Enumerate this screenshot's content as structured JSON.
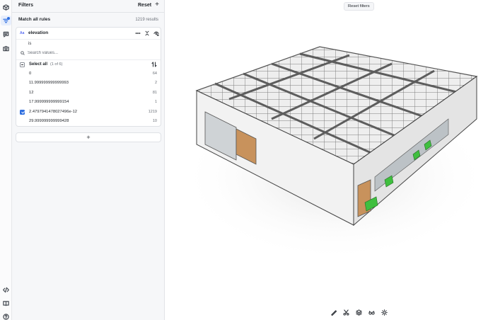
{
  "rail": {
    "top": [
      "cube-icon",
      "filter-icon",
      "comment-icon",
      "camera-icon"
    ],
    "bottom": [
      "code-icon",
      "book-icon",
      "help-icon"
    ]
  },
  "filters": {
    "title": "Filters",
    "reset_label": "Reset",
    "add_label": "+",
    "match_label": "Match all rules",
    "results_label": "1219 results",
    "rule": {
      "type_badge": "Aa",
      "property": "elevation",
      "operator": "is",
      "search_placeholder": "Search values...",
      "select_all_label": "Select all",
      "select_all_count": "(1 of 6)",
      "values": [
        {
          "value": "0",
          "count": "64",
          "checked": false
        },
        {
          "value": "11.999999999999993",
          "count": "2",
          "checked": false
        },
        {
          "value": "12",
          "count": "81",
          "checked": false
        },
        {
          "value": "17.999999999999154",
          "count": "1",
          "checked": false
        },
        {
          "value": "2.4797941478027496e-12",
          "count": "1219",
          "checked": true
        },
        {
          "value": "29.999999999999428",
          "count": "10",
          "checked": false
        }
      ]
    },
    "add_rule_label": "+"
  },
  "viewer": {
    "reset_filters_label": "Reset filters",
    "accent_highlight": "#3fbf3f",
    "toolbar": [
      "ruler-icon",
      "scissors-icon",
      "layers-icon",
      "glasses-icon",
      "sun-icon"
    ]
  }
}
